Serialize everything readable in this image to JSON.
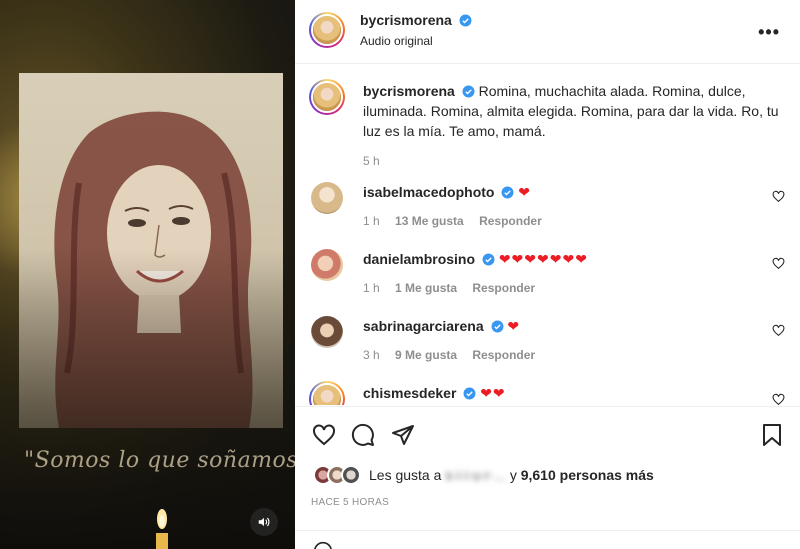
{
  "media": {
    "overlay_text": "\"Somos lo que soñamos\"",
    "mute_icon": "speaker-icon"
  },
  "header": {
    "username": "bycrismorena",
    "subtitle": "Audio original",
    "more_icon": "more-options-icon"
  },
  "caption": {
    "username": "bycrismorena",
    "text": "Romina, muchachita alada. Romina, dulce, iluminada. Romina, almita elegida. Romina, para dar la vida. Ro, tu luz es la mía. Te amo, mamá.",
    "time": "5 h"
  },
  "comments": [
    {
      "username": "isabelmacedophoto",
      "verified": true,
      "hearts": "❤",
      "time": "1 h",
      "likes": "13 Me gusta",
      "reply": "Responder"
    },
    {
      "username": "danielambrosino",
      "verified": true,
      "hearts": "❤❤❤❤❤❤❤",
      "time": "1 h",
      "likes": "1 Me gusta",
      "reply": "Responder"
    },
    {
      "username": "sabrinagarciarena",
      "verified": true,
      "hearts": "❤",
      "time": "3 h",
      "likes": "9 Me gusta",
      "reply": "Responder"
    },
    {
      "username": "chismesdeker",
      "verified": true,
      "hearts": "❤❤",
      "time": "",
      "likes": "",
      "reply": ""
    }
  ],
  "actions": {
    "likes_prefix": "Les gusta a",
    "likes_blurred": "s·i·i·u·r·...",
    "likes_suffix": "y",
    "likes_count": "9,610 personas más",
    "timestamp": "HACE 5 HORAS"
  },
  "colors": {
    "verified": "#3897f0",
    "heart": "#ed1c24",
    "muted_text": "#8e8e8e"
  }
}
